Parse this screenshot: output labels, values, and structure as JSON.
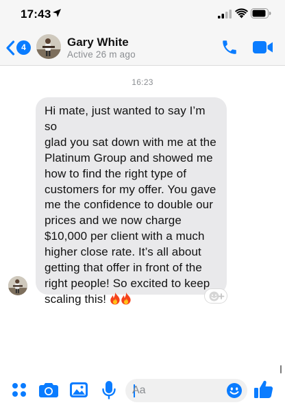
{
  "status_bar": {
    "time": "17:43",
    "location_icon": "location-arrow-icon",
    "signal_icon": "cellular-signal-icon",
    "wifi_icon": "wifi-icon",
    "battery_icon": "battery-icon"
  },
  "header": {
    "back_icon": "chevron-left-icon",
    "unread_count": "4",
    "contact_name": "Gary White",
    "active_status": "Active 26 m ago",
    "call_icon": "phone-icon",
    "video_icon": "video-camera-icon"
  },
  "conversation": {
    "timestamp": "16:23",
    "messages": [
      {
        "direction": "incoming",
        "text": "Hi mate, just wanted to say I’m so\nglad you sat down with me at the\nPlatinum Group and showed me\nhow to find the right type of\ncustomers for my offer. You gave\nme the confidence to double our\nprices and we now charge\n$10,000 per client with a much\nhigher close rate. It’s all about\ngetting that offer in front of the\nright people! So excited to keep\nscaling this!",
        "emoji": [
          "fire-emoji",
          "fire-emoji"
        ],
        "reaction_icon": "add-reaction-icon"
      }
    ]
  },
  "composer": {
    "more_icon": "four-dots-icon",
    "camera_icon": "camera-icon",
    "gallery_icon": "photo-gallery-icon",
    "mic_icon": "microphone-icon",
    "input_placeholder": "Aa",
    "input_value": "",
    "emoji_icon": "smiley-icon",
    "like_icon": "thumbs-up-icon"
  },
  "colors": {
    "accent": "#0a7cff",
    "bubble_incoming": "#e9e9eb",
    "header_background": "#f6f6f6",
    "secondary_text": "#8a8d91"
  }
}
